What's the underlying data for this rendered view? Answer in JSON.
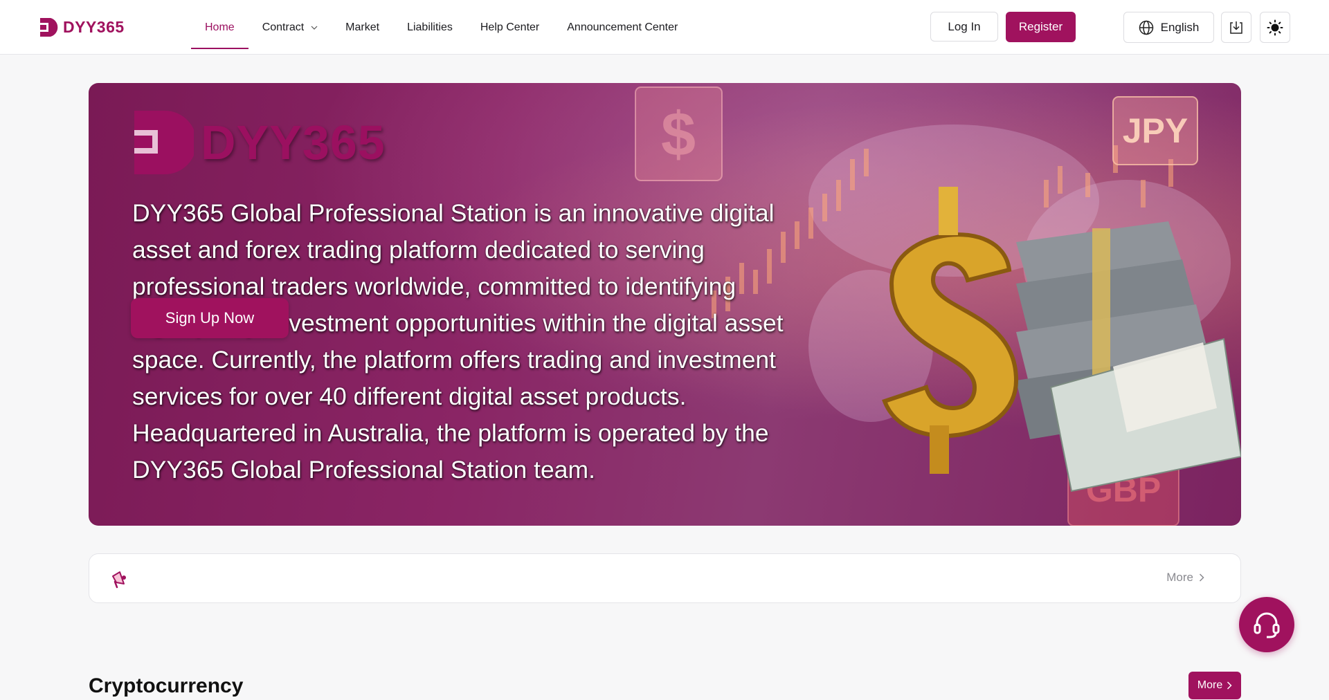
{
  "header": {
    "brand": "DYY365",
    "nav": [
      {
        "label": "Home",
        "active": true
      },
      {
        "label": "Contract",
        "dropdown": true
      },
      {
        "label": "Market"
      },
      {
        "label": "Liabilities"
      },
      {
        "label": "Help Center"
      },
      {
        "label": "Announcement Center"
      }
    ],
    "login_label": "Log In",
    "register_label": "Register",
    "language_label": "English",
    "icons": {
      "language": "globe-icon",
      "download": "download-icon",
      "theme": "sun-icon"
    }
  },
  "banner": {
    "brand": "DYY365",
    "description": "DYY365 Global Professional Station is an innovative digital asset and forex trading platform dedicated to serving professional traders worldwide, committed to identifying high-quality, investment opportunities within the digital asset space. Currently, the platform offers trading and investment services for over 40 different digital asset products. Headquartered in Australia, the platform is operated by the DYY365 Global Professional Station team.",
    "signup_label": "Sign Up Now",
    "currency_tags": [
      "$",
      "JPY",
      "GBP"
    ]
  },
  "announcement": {
    "icon": "megaphone-icon",
    "more_label": "More"
  },
  "section": {
    "title": "Cryptocurrency",
    "more_label": "More"
  },
  "support": {
    "icon": "headset-icon"
  },
  "colors": {
    "brand": "#a0125e",
    "background": "#f7f7f8"
  }
}
